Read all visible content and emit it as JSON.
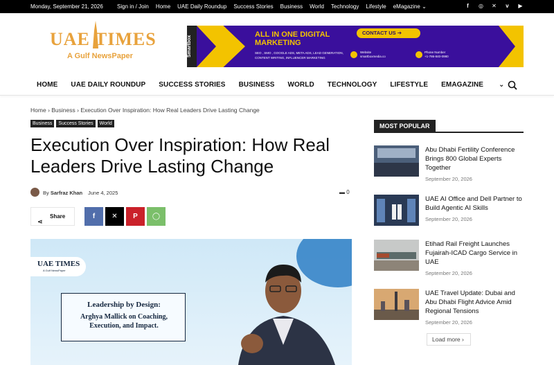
{
  "topbar": {
    "date": "Monday, September 21, 2026",
    "links": [
      "Sign in / Join",
      "Home",
      "UAE Daily Roundup",
      "Success Stories",
      "Business",
      "World",
      "Technology",
      "Lifestyle",
      "eMagazine"
    ],
    "social_icons": [
      "facebook-icon",
      "instagram-icon",
      "x-icon",
      "vimeo-icon",
      "youtube-icon"
    ]
  },
  "logo": {
    "title": "UAE TIMES",
    "tagline": "A Gulf NewsPaper"
  },
  "ad": {
    "side": "Smartbox",
    "headline1": "ALL IN ONE DIGITAL",
    "headline2": "MARKETING",
    "services": "SEO , SMO , GOOGLE ADS, META ADS, LEAD GENERATION, CONTENT WRITING, INFLUENCER MARKETING",
    "cta": "CONTACT US",
    "website_label": "Website",
    "website": "smartboxmedia.co",
    "phone_label": "Phone Number",
    "phone": "+1-786-840-0980"
  },
  "menu": {
    "items": [
      "HOME",
      "UAE DAILY ROUNDUP",
      "SUCCESS STORIES",
      "BUSINESS",
      "WORLD",
      "TECHNOLOGY",
      "LIFESTYLE",
      "EMAGAZINE"
    ]
  },
  "breadcrumb": {
    "home": "Home",
    "section": "Business",
    "current": "Execution Over Inspiration: How Real Leaders Drive Lasting Change"
  },
  "tags": [
    "Business",
    "Success Stories",
    "World"
  ],
  "article": {
    "title": "Execution Over Inspiration: How Real Leaders Drive Lasting Change",
    "by": "By",
    "author": "Sarfraz Khan",
    "date": "June 4, 2025",
    "comments": "0"
  },
  "share": {
    "label": "Share"
  },
  "hero": {
    "logo": "UAE TIMES",
    "logo_tag": "A Gulf NewsPaper",
    "line1": "Leadership by Design:",
    "line2": "Arghya Mallick on Coaching,",
    "line3": "Execution, and Impact."
  },
  "sidebar": {
    "heading": "MOST POPULAR",
    "posts": [
      {
        "title": "Abu Dhabi Fertility Conference Brings 800 Global Experts Together",
        "date": "September 20, 2026"
      },
      {
        "title": "UAE AI Office and Dell Partner to Build Agentic AI Skills",
        "date": "September 20, 2026"
      },
      {
        "title": "Etihad Rail Freight Launches Fujairah-ICAD Cargo Service in UAE",
        "date": "September 20, 2026"
      },
      {
        "title": "UAE Travel Update: Dubai and Abu Dhabi Flight Advice Amid Regional Tensions",
        "date": "September 20, 2026"
      }
    ],
    "load_more": "Load more"
  },
  "colors": {
    "accent": "#e8a23c",
    "ad_bg": "#3a0f9c",
    "ad_yellow": "#f3c300",
    "facebook": "#516eab",
    "x": "#000000",
    "pinterest": "#ca212a",
    "whatsapp": "#7bbf6a"
  }
}
